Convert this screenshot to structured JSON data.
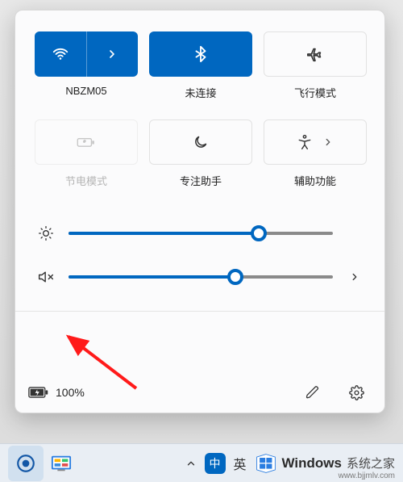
{
  "colors": {
    "accent": "#0067c0"
  },
  "tiles": {
    "wifi": {
      "label": "NBZM05",
      "active": true,
      "has_expand": true
    },
    "bluetooth": {
      "label": "未连接",
      "active": true,
      "has_expand": false
    },
    "airplane": {
      "label": "飞行模式",
      "active": false,
      "has_expand": false
    },
    "battery_saver": {
      "label": "节电模式",
      "active": false,
      "disabled": true
    },
    "focus": {
      "label": "专注助手",
      "active": false,
      "has_expand": false
    },
    "accessibility": {
      "label": "辅助功能",
      "active": false,
      "has_expand": true
    }
  },
  "sliders": {
    "brightness": {
      "value": 72
    },
    "volume": {
      "value": 63,
      "muted": true
    }
  },
  "status": {
    "battery_percent_text": "100%"
  },
  "taskbar": {
    "ime_mode_badge": "中",
    "ime_lang": "英"
  },
  "watermark": {
    "brand": "Windows",
    "suffix": "系统之家",
    "url": "www.bjjmlv.com"
  }
}
